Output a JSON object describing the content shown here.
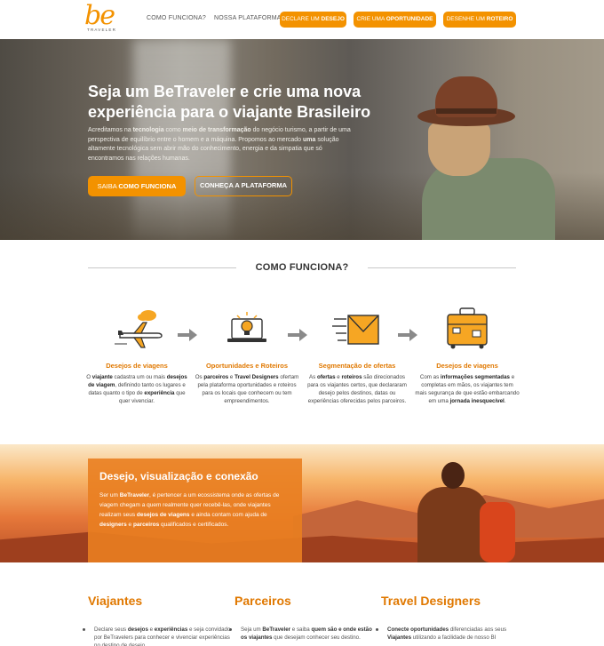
{
  "nav": {
    "logo_mark": "be",
    "logo_sub": "TRAVELER",
    "links": [
      "COMO FUNCIONA?",
      "NOSSA PLATAFORMA"
    ],
    "buttons": [
      {
        "pre": "DECLARE UM ",
        "bold": "DESEJO"
      },
      {
        "pre": "CRIE UMA ",
        "bold": "OPORTUNIDADE"
      },
      {
        "pre": "DESENHE UM ",
        "bold": "ROTEIRO"
      }
    ]
  },
  "hero": {
    "title": "Seja um BeTraveler e crie uma nova experiência para o viajante Brasileiro",
    "text_parts": {
      "p1": "Acreditamos na ",
      "b1": "tecnologia",
      "p2": " como ",
      "b2": "meio de transformação",
      "p3": " do negócio turismo, a partir de uma perspectiva de equilíbrio entre o homem e a máquina. Propomos ao mercado ",
      "b3": "uma",
      "p4": " solução altamente tecnológica sem abrir mão do conhecimento, energia e da simpatia que só encontramos nas relações humanas."
    },
    "btn_primary_pre": "SAIBA ",
    "btn_primary_bold": "COMO FUNCIONA",
    "btn_secondary": "CONHEÇA A PLATAFORMA"
  },
  "how": {
    "title": "COMO FUNCIONA?",
    "steps": [
      {
        "title": "Desejos de viagens",
        "icon": "airplane-cloud-icon"
      },
      {
        "title": "Oportunidades e Roteiros",
        "icon": "laptop-lightbulb-icon"
      },
      {
        "title": "Segmentação de ofertas",
        "icon": "envelope-icon"
      },
      {
        "title": "Desejos de viagens",
        "icon": "suitcase-icon"
      }
    ],
    "step1": {
      "p1": "O ",
      "b1": "viajante",
      "p2": " cadastra um ou mais ",
      "b2": "desejos de viagem",
      "p3": ", definindo tanto os lugares e datas quanto o tipo de ",
      "b3": "experiência",
      "p4": " que quer vivenciar."
    },
    "step2": {
      "p1": "Os ",
      "b1": "parceiros",
      "p2": " e ",
      "b2": "Travel Designers",
      "p3": " ofertam pela plataforma oportunidades e roteiros para os locais que conhecem ou tem empreendimentos."
    },
    "step3": {
      "p1": "As ",
      "b1": "ofertas",
      "p2": " e ",
      "b2": "roteiros",
      "p3": " são direcionados para os viajantes certos, que declararam desejo pelos destinos, datas ou experiências oferecidas pelos parceiros."
    },
    "step4": {
      "p1": "Com as ",
      "b1": "informações segmentadas",
      "p2": " e completas em mãos, os viajantes tem mais segurança de que estão embarcando em uma ",
      "b2": "jornada inesquecível",
      "p3": "."
    }
  },
  "banner": {
    "title": "Desejo, visualização e conexão",
    "p1": "Ser um ",
    "b1": "BeTraveler",
    "p2": ", é pertencer a um ecossistema onde as ofertas de viagem chegam a quem realmente quer recebê-las, onde viajantes realizam seus ",
    "b2": "desejos de viagens",
    "p3": " e ainda contam com ajuda de ",
    "b3": "designers",
    "p4": " e ",
    "b4": "parceiros",
    "p5": " qualificados e certificados."
  },
  "columns": [
    {
      "title": "Viajantes",
      "p1": "Declare seus ",
      "b1": "desejos",
      "p2": " e ",
      "b2": "experiências",
      "p3": " e seja convidado por BeTravelers para conhecer e vivenciar experiências no destino de desejo."
    },
    {
      "title": "Parceiros",
      "p1": "Seja um ",
      "b1": "BeTraveler",
      "p2": " e saiba ",
      "b2": "quem são e onde estão os viajantes",
      "p3": " que desejam conhecer seu destino."
    },
    {
      "title": "Travel Designers",
      "p1": "",
      "b1": "Conecte oportunidades",
      "p2": " diferenciadas aos seus ",
      "b2": "Viajantes",
      "p3": " utilizando a facilidade de nosso BI"
    }
  ],
  "colors": {
    "accent": "#f39200",
    "accent_dark": "#e07800"
  }
}
